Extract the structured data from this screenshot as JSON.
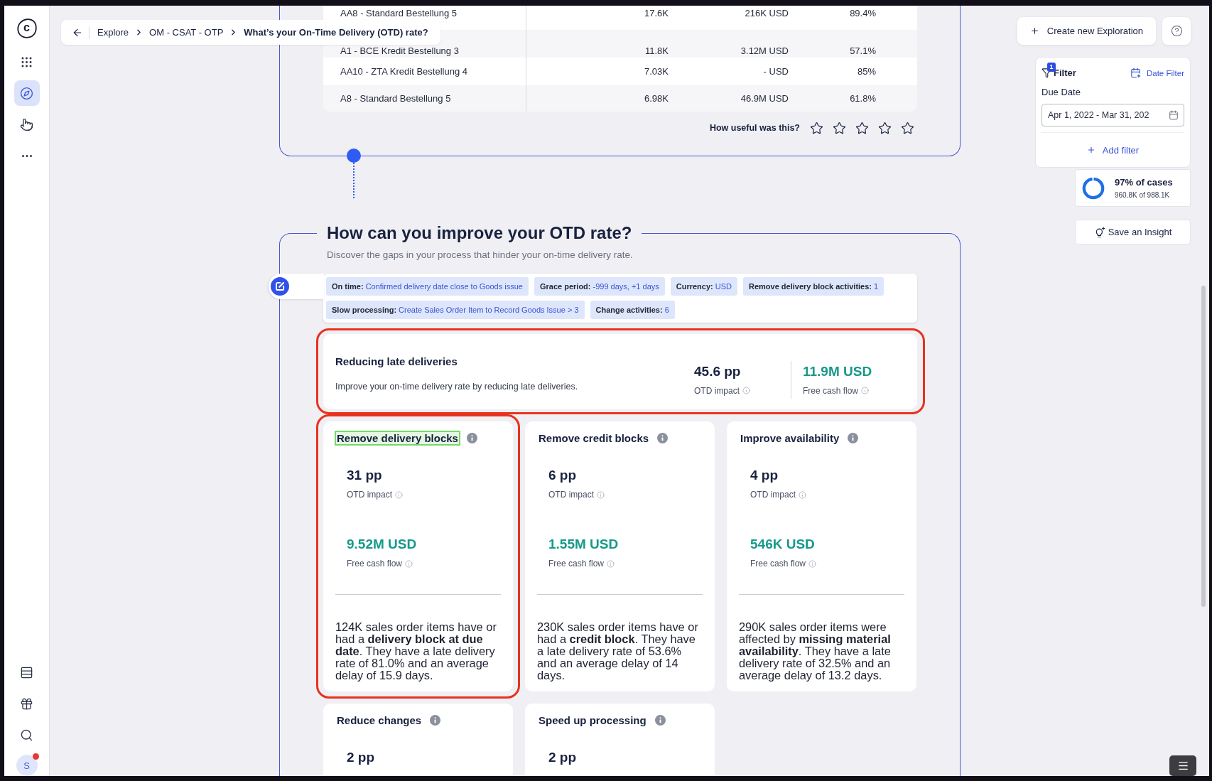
{
  "sidebar": {
    "logo": "c",
    "nav": [
      {
        "kind": "apps",
        "selected": false
      },
      {
        "kind": "explore",
        "selected": true
      },
      {
        "kind": "touch",
        "selected": false
      },
      {
        "kind": "more",
        "selected": false
      }
    ],
    "user": {
      "initial": "S",
      "notification": true
    }
  },
  "breadcrumb": [
    {
      "label": "Explore",
      "current": false
    },
    {
      "label": "OM - CSAT - OTP",
      "current": false
    },
    {
      "label": "What’s your On-Time Delivery (OTD) rate?",
      "current": true
    }
  ],
  "table": {
    "rows": [
      {
        "cells": [
          "AA8 - Standard Bestellung 5",
          "17.6K",
          "216K USD",
          "89.4%"
        ]
      },
      {
        "cells": [
          "A1 - BCE Kredit Bestellung 3",
          "11.8K",
          "3.12M USD",
          "57.1%"
        ]
      },
      {
        "cells": [
          "AA10 - ZTA Kredit Bestellung 4",
          "7.03K",
          "- USD",
          "85%"
        ]
      },
      {
        "cells": [
          "A8 - Standard Bestellung 5",
          "6.98K",
          "46.9M USD",
          "61.8%"
        ]
      }
    ]
  },
  "rating": {
    "question": "How useful was this?",
    "stars": 0
  },
  "improvement": {
    "title": "How can you improve your OTD rate?",
    "subtitle": "Discover the gaps in your process that hinder your on-time delivery rate.",
    "tags": [
      {
        "label": "On time:",
        "value": "Confirmed delivery date close to Goods issue"
      },
      {
        "label": "Grace period:",
        "value": "-999 days, +1 days"
      },
      {
        "label": "Currency:",
        "value": "USD"
      },
      {
        "label": "Remove delivery block activities:",
        "value": "1"
      },
      {
        "label": "Slow processing:",
        "value": "Create Sales Order Item to Record Goods Issue > 3"
      },
      {
        "label": "Change activities:",
        "value": "6"
      }
    ],
    "summary": {
      "title": "Reducing late deliveries",
      "text": "Improve your on-time delivery rate by reducing late deliveries.",
      "highlighted": true,
      "metrics": [
        {
          "kind": "impact",
          "value": "45.6 pp",
          "label": "OTD impact"
        },
        {
          "kind": "cash",
          "value": "11.9M USD",
          "label": "Free cash flow"
        }
      ]
    },
    "cards": [
      {
        "title": "Remove delivery blocks",
        "focused": true,
        "highlighted": true,
        "metrics": [
          {
            "kind": "impact",
            "value": "31 pp",
            "label": "OTD impact"
          },
          {
            "kind": "cash",
            "value": "9.52M USD",
            "label": "Free cash flow"
          }
        ],
        "text": "124K sales order items have or had a **delivery block at due date**. They have a late delivery rate of 81.0% and an average delay of 15.9 days."
      },
      {
        "title": "Remove credit blocks",
        "focused": false,
        "highlighted": false,
        "metrics": [
          {
            "kind": "impact",
            "value": "6 pp",
            "label": "OTD impact"
          },
          {
            "kind": "cash",
            "value": "1.55M USD",
            "label": "Free cash flow"
          }
        ],
        "text": "230K sales order items have or had a **credit block**. They have a late delivery rate of 53.6% and an average delay of 14 days."
      },
      {
        "title": "Improve availability",
        "focused": false,
        "highlighted": false,
        "metrics": [
          {
            "kind": "impact",
            "value": "4 pp",
            "label": "OTD impact"
          },
          {
            "kind": "cash",
            "value": "546K USD",
            "label": "Free cash flow"
          }
        ],
        "text": "290K sales order items were affected by **missing material availability**. They have a late delivery rate of 32.5% and an average delay of 13.2 days."
      },
      {
        "title": "Reduce changes",
        "focused": false,
        "highlighted": false,
        "metrics": [
          {
            "kind": "impact",
            "value": "2 pp"
          }
        ]
      },
      {
        "title": "Speed up processing",
        "focused": false,
        "highlighted": false,
        "metrics": [
          {
            "kind": "impact",
            "value": "2 pp"
          }
        ]
      }
    ]
  },
  "actions": {
    "create": "Create new Exploration"
  },
  "filter": {
    "title": "Filter",
    "count": "1",
    "date_filter": "Date Filter",
    "field_label": "Due Date",
    "field_value": "Apr 1, 2022 - Mar 31, 202",
    "add": "Add filter"
  },
  "cases": {
    "label": "97% of cases",
    "detail": "960.8K of 988.1K",
    "level": 0.97
  },
  "insight_button": "Save an Insight"
}
